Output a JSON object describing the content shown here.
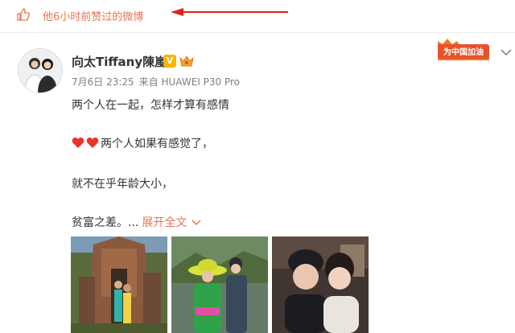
{
  "header": {
    "liked_text": "他6小时前赞过的微博",
    "thumb_icon": "thumbs-up-icon",
    "accent_color": "#eb7350"
  },
  "post": {
    "username": "向太Tiffany陳嵐",
    "verified_badge": "V",
    "timestamp": "7月6日 23:25",
    "source": "来自 HUAWEI P30 Pro",
    "lines": [
      "两个人在一起，怎样才算有感情",
      "两个人如果有感觉了，",
      "就不在乎年龄大小，",
      "贫富之差。..."
    ],
    "expand_label": "展开全文",
    "topic_badge_text": "为中国加油",
    "images": [
      "temple-photo",
      "forest-photo",
      "portrait-photo"
    ]
  }
}
